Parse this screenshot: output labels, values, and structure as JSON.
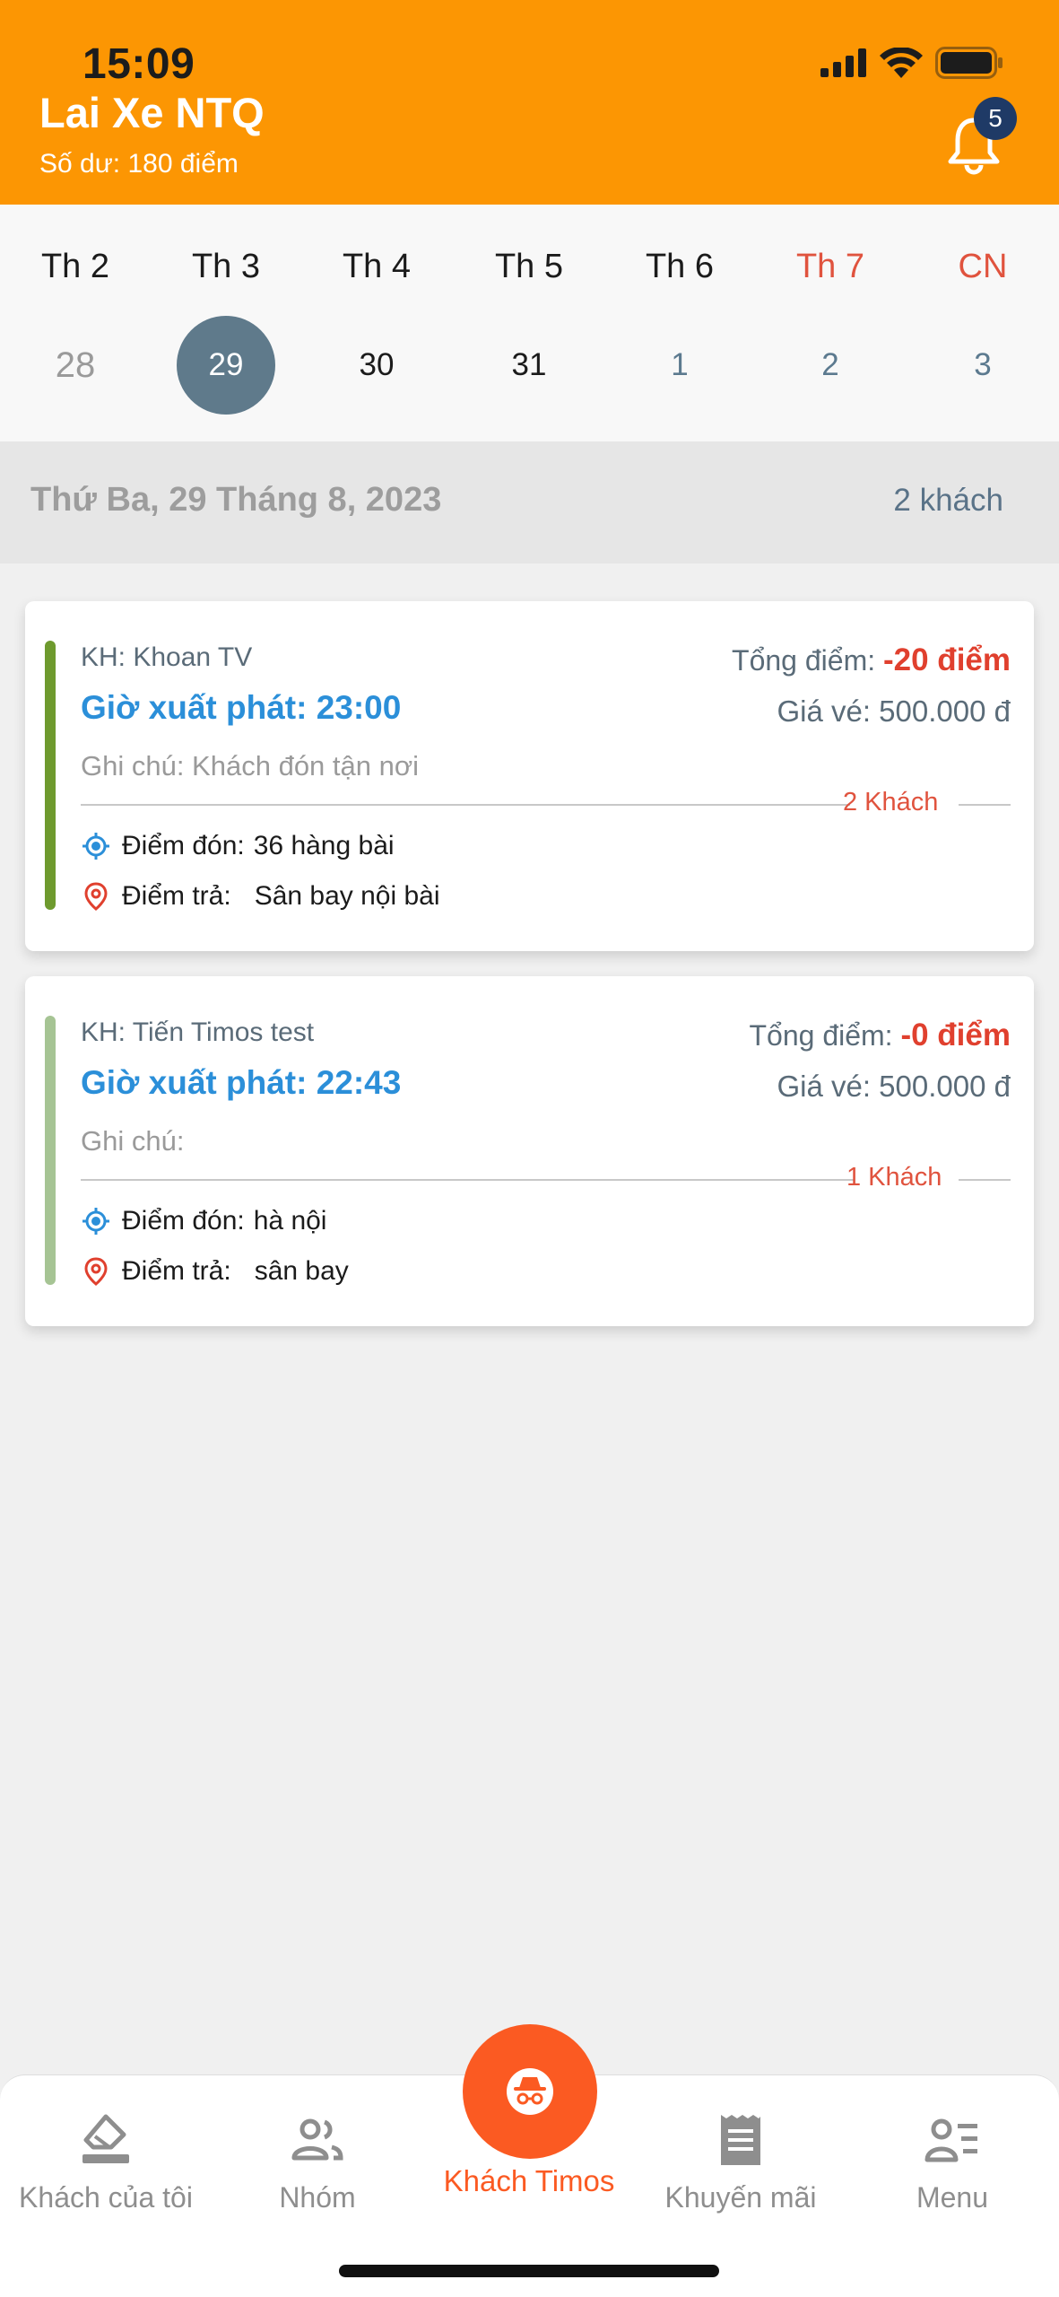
{
  "status_bar": {
    "time": "15:09"
  },
  "header": {
    "title": "Lai Xe NTQ",
    "balance": "Số dư: 180 điểm",
    "notification_count": "5",
    "bg_color": "#fc9603"
  },
  "week": {
    "days": [
      {
        "name": "Th 2",
        "num": "28",
        "state": "past"
      },
      {
        "name": "Th 3",
        "num": "29",
        "state": "selected"
      },
      {
        "name": "Th 4",
        "num": "30",
        "state": "normal"
      },
      {
        "name": "Th 5",
        "num": "31",
        "state": "normal"
      },
      {
        "name": "Th 6",
        "num": "1",
        "state": "future"
      },
      {
        "name": "Th 7",
        "num": "2",
        "state": "future",
        "weekend": true
      },
      {
        "name": "CN",
        "num": "3",
        "state": "future",
        "weekend": true
      }
    ]
  },
  "date_bar": {
    "title": "Thứ Ba, 29 Tháng 8, 2023",
    "count": "2 khách"
  },
  "trips": [
    {
      "customer": "KH: Khoan TV",
      "departure": "Giờ xuất phát: 23:00",
      "note": "Ghi chú: Khách đón tận nơi",
      "points_label": "Tổng điểm:",
      "points_value": "-20 điểm",
      "price": "Giá vé: 500.000 đ",
      "guests": "2 Khách",
      "pickup_label": "Điểm đón:",
      "pickup_value": "36 hàng bài",
      "dropoff_label": "Điểm trả:",
      "dropoff_value": "Sân bay nội bài",
      "accent_color": "#6e9a2e"
    },
    {
      "customer": "KH: Tiến Timos test",
      "departure": "Giờ xuất phát: 22:43",
      "note": "Ghi chú:",
      "points_label": "Tổng điểm:",
      "points_value": "-0 điểm",
      "price": "Giá vé: 500.000 đ",
      "guests": "1 Khách",
      "pickup_label": "Điểm đón:",
      "pickup_value": "hà nội",
      "dropoff_label": "Điểm trả:",
      "dropoff_value": "sân bay",
      "accent_color": "#a6c494"
    }
  ],
  "bottom_nav": {
    "items": [
      {
        "label": "Khách của tôi",
        "icon": "eraser-icon"
      },
      {
        "label": "Nhóm",
        "icon": "group-icon"
      },
      {
        "label": "Khách Timos",
        "icon": "incognito-icon",
        "active": true
      },
      {
        "label": "Khuyến mãi",
        "icon": "receipt-icon"
      },
      {
        "label": "Menu",
        "icon": "menu-list-icon"
      }
    ],
    "active_color": "#fb5a22"
  }
}
